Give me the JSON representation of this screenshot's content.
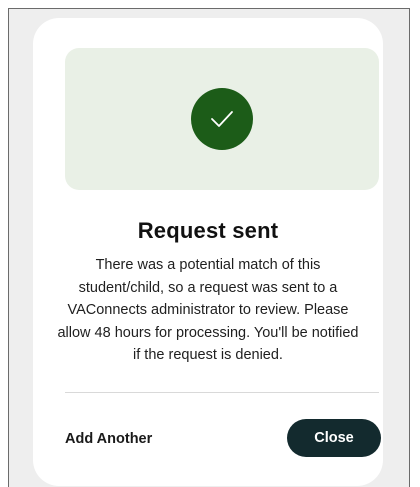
{
  "dialog": {
    "title": "Request sent",
    "message": "There was a potential match of this student/child, so a request was sent to a VAConnects administrator to review. Please allow 48 hours for processing. You'll be notified if the request is denied.",
    "status_icon": "check-icon",
    "add_another_label": "Add Another",
    "close_label": "Close"
  },
  "colors": {
    "banner_bg": "#e9f0e6",
    "success_green": "#1c5c18",
    "close_button_bg": "#132a2e"
  }
}
